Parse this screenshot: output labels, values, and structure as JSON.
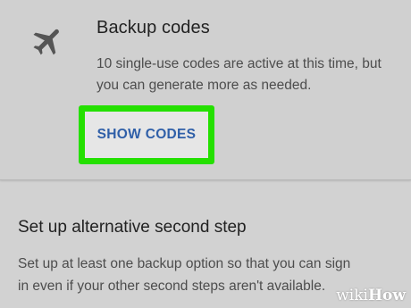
{
  "backup_codes": {
    "icon": "airplane-icon",
    "title": "Backup codes",
    "description": "10 single-use codes are active at this time, but you can generate more as needed.",
    "button_label": "SHOW CODES",
    "highlight_color": "#24e000",
    "button_color": "#2f5fa8"
  },
  "alternative_step": {
    "title": "Set up alternative second step",
    "description": "Set up at least one backup option so that you can sign in even if your other second steps aren't available."
  },
  "watermark": {
    "prefix": "wiki",
    "suffix": "How"
  }
}
